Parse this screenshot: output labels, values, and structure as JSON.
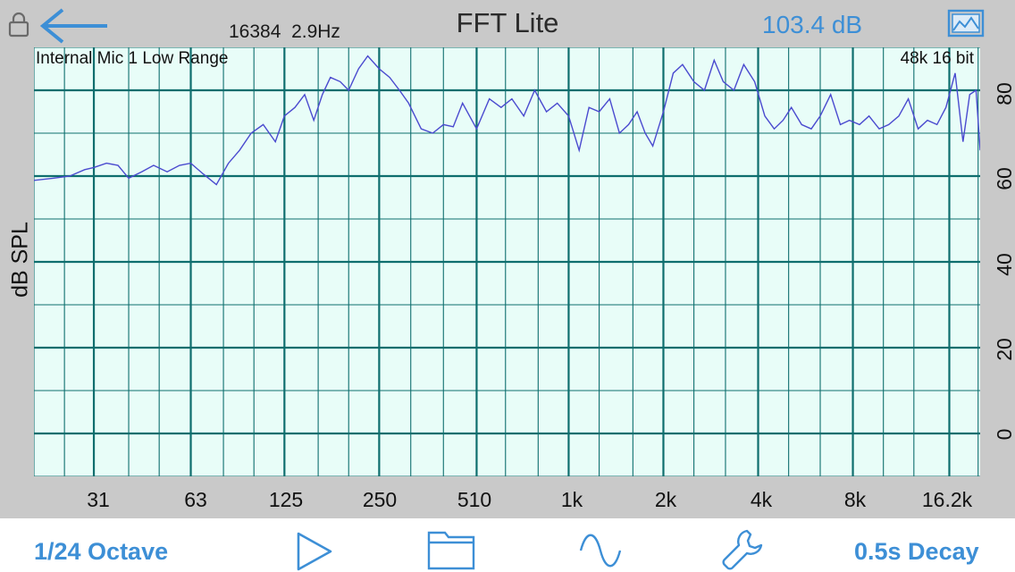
{
  "header": {
    "fft_size": "16384",
    "resolution": "2.9Hz",
    "title": "FFT Lite",
    "level": "103.4 dB"
  },
  "plot": {
    "input_label": "Internal Mic 1 Low Range",
    "format_label": "48k 16 bit",
    "ylabel": "dB SPL",
    "y_ticks": [
      "80",
      "60",
      "40",
      "20",
      "0"
    ],
    "x_ticks": [
      "31",
      "63",
      "125",
      "250",
      "510",
      "1k",
      "2k",
      "4k",
      "8k",
      "16.2k"
    ]
  },
  "chart_data": {
    "type": "line",
    "xscale": "log",
    "ylabel": "dB SPL",
    "ylim": [
      -10,
      90
    ],
    "y_ticks": [
      0,
      20,
      40,
      60,
      80
    ],
    "x_ticks": [
      "31",
      "63",
      "125",
      "250",
      "510",
      "1k",
      "2k",
      "4k",
      "8k",
      "16.2k"
    ],
    "grid": true,
    "series": [
      {
        "x": [
          20,
          23,
          26,
          29,
          31,
          34,
          37,
          40,
          44,
          48,
          53,
          58,
          63,
          69,
          76,
          83,
          90,
          98,
          107,
          117,
          125,
          135,
          145,
          155,
          165,
          175,
          188,
          200,
          215,
          230,
          250,
          270,
          290,
          310,
          340,
          370,
          400,
          430,
          460,
          510,
          560,
          610,
          660,
          720,
          780,
          850,
          920,
          1000,
          1080,
          1160,
          1250,
          1350,
          1450,
          1550,
          1650,
          1750,
          1850,
          2000,
          2150,
          2300,
          2500,
          2700,
          2900,
          3100,
          3350,
          3600,
          3900,
          4200,
          4500,
          4800,
          5100,
          5500,
          5900,
          6300,
          6800,
          7300,
          7800,
          8400,
          9000,
          9700,
          10400,
          11200,
          12000,
          12900,
          13800,
          14800,
          15800,
          16900,
          17900,
          18800,
          19700,
          20300
        ],
        "y": [
          59,
          59.5,
          60,
          61.5,
          62,
          63,
          62.5,
          59.5,
          61,
          62.5,
          61,
          62.5,
          63,
          60.5,
          58,
          63,
          66,
          70,
          72,
          68,
          74,
          76,
          79,
          73,
          79,
          83,
          82,
          80,
          85,
          88,
          85,
          83,
          80,
          77,
          71,
          70,
          72,
          71.5,
          77,
          71,
          78,
          76,
          78,
          74,
          80,
          75,
          77,
          74,
          66,
          76,
          75,
          78,
          70,
          72,
          75,
          70,
          67,
          75,
          84,
          86,
          82,
          80,
          87,
          82,
          80,
          86,
          82,
          74,
          71,
          73,
          76,
          72,
          71,
          74,
          79,
          72,
          73,
          72,
          74,
          71,
          72,
          74,
          78,
          71,
          73,
          72,
          76,
          84,
          68,
          79,
          80,
          66
        ]
      }
    ]
  },
  "toolbar": {
    "resolution_label": "1/24 Octave",
    "decay_label": "0.5s Decay"
  },
  "icons": {
    "lock": "lock-icon",
    "back": "arrow-left-icon",
    "image": "image-icon",
    "play": "play-icon",
    "folder": "folder-icon",
    "generator": "sine-wave-icon",
    "settings": "wrench-icon"
  },
  "colors": {
    "accent": "#3d8fd6",
    "plot_bg": "#e8fdf8",
    "grid": "#0e6e6e",
    "trace": "#4a4acf"
  }
}
